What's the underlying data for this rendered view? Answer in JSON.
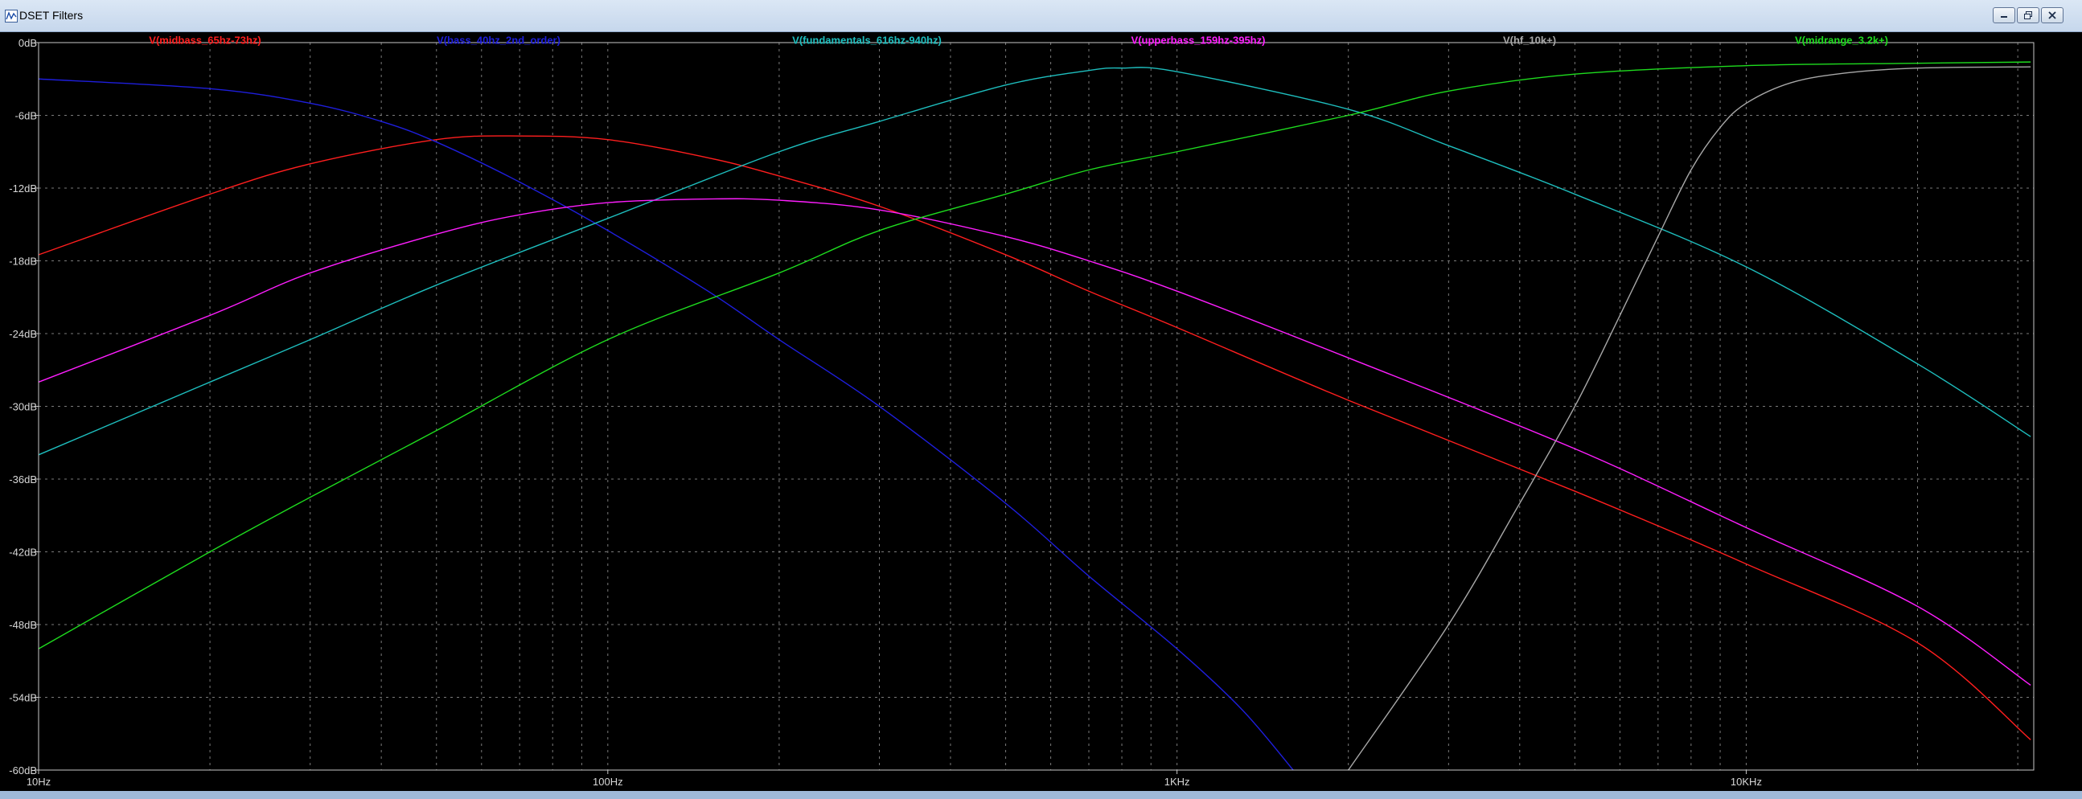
{
  "window": {
    "title": "DSET Filters",
    "icon": "ltspice-waveform-icon",
    "controls": [
      "minimize-icon",
      "restore-icon",
      "close-icon"
    ]
  },
  "chart_data": {
    "type": "line",
    "xscale": "log",
    "xlim": [
      10,
      32000
    ],
    "ylim": [
      -60,
      0
    ],
    "xlabel": "",
    "ylabel": "",
    "title": "",
    "grid": true,
    "legend": "top",
    "background": "#000000",
    "grid_color": "#7a7a7a",
    "x_tick_labels": [
      {
        "value": 10,
        "label": "10Hz"
      },
      {
        "value": 100,
        "label": "100Hz"
      },
      {
        "value": 1000,
        "label": "1KHz"
      },
      {
        "value": 10000,
        "label": "10KHz"
      }
    ],
    "y_tick_labels": [
      {
        "value": 0,
        "label": "0dB"
      },
      {
        "value": -6,
        "label": "-6dB"
      },
      {
        "value": -12,
        "label": "-12dB"
      },
      {
        "value": -18,
        "label": "-18dB"
      },
      {
        "value": -24,
        "label": "-24dB"
      },
      {
        "value": -30,
        "label": "-30dB"
      },
      {
        "value": -36,
        "label": "-36dB"
      },
      {
        "value": -42,
        "label": "-42dB"
      },
      {
        "value": -48,
        "label": "-48dB"
      },
      {
        "value": -54,
        "label": "-54dB"
      },
      {
        "value": -60,
        "label": "-60dB"
      }
    ],
    "series": [
      {
        "name": "V(midbass_65hz-73hz)",
        "color": "#ff1e1e",
        "x": [
          10,
          20,
          30,
          50,
          70,
          100,
          150,
          200,
          300,
          500,
          700,
          1000,
          2000,
          5000,
          10000,
          20000,
          31600
        ],
        "y": [
          -17.5,
          -12.5,
          -10.0,
          -8.0,
          -7.7,
          -8.0,
          -9.5,
          -11.0,
          -13.5,
          -17.5,
          -20.5,
          -23.5,
          -29.5,
          -37.0,
          -43.0,
          -49.5,
          -57.5
        ]
      },
      {
        "name": "V(bass_40hz_2nd_order)",
        "color": "#1e1edc",
        "x": [
          10,
          20,
          30,
          40,
          50,
          70,
          100,
          150,
          200,
          300,
          500,
          700,
          1000,
          1300,
          1600
        ],
        "y": [
          -3.0,
          -3.8,
          -5.0,
          -6.5,
          -8.2,
          -11.5,
          -15.5,
          -20.5,
          -24.5,
          -30.0,
          -38.0,
          -44.0,
          -50.0,
          -55.0,
          -60.0
        ]
      },
      {
        "name": "V(fundamentals_616hz-940hz)",
        "color": "#1ebebe",
        "x": [
          10,
          20,
          30,
          50,
          100,
          200,
          300,
          500,
          700,
          800,
          1000,
          2000,
          3000,
          5000,
          10000,
          20000,
          31600
        ],
        "y": [
          -34.0,
          -28.0,
          -24.5,
          -20.0,
          -14.5,
          -9.0,
          -6.5,
          -3.5,
          -2.3,
          -2.1,
          -2.4,
          -5.5,
          -8.5,
          -12.5,
          -18.5,
          -26.5,
          -32.5
        ]
      },
      {
        "name": "V(upperbass_159hz-395hz)",
        "color": "#ff1eff",
        "x": [
          10,
          20,
          30,
          50,
          70,
          100,
          150,
          200,
          300,
          500,
          700,
          1000,
          2000,
          5000,
          10000,
          20000,
          31600
        ],
        "y": [
          -28.0,
          -22.5,
          -19.0,
          -15.8,
          -14.2,
          -13.2,
          -12.9,
          -13.0,
          -13.8,
          -16.0,
          -18.0,
          -20.5,
          -26.0,
          -33.5,
          -40.0,
          -46.5,
          -53.0
        ]
      },
      {
        "name": "V(hf_10k+)",
        "color": "#a8a8a8",
        "x": [
          2000,
          3000,
          4000,
          5000,
          6000,
          7000,
          8000,
          9000,
          10000,
          12000,
          15000,
          20000,
          31600
        ],
        "y": [
          -60.0,
          -48.0,
          -38.0,
          -30.0,
          -22.5,
          -16.0,
          -10.5,
          -7.0,
          -5.0,
          -3.3,
          -2.5,
          -2.1,
          -2.0
        ]
      },
      {
        "name": "V(midrange_3.2k+)",
        "color": "#1edc1e",
        "x": [
          10,
          20,
          30,
          50,
          100,
          200,
          300,
          500,
          700,
          1000,
          2000,
          3000,
          5000,
          10000,
          20000,
          31600
        ],
        "y": [
          -50.0,
          -42.0,
          -37.5,
          -32.0,
          -24.5,
          -19.0,
          -15.5,
          -12.5,
          -10.5,
          -9.0,
          -6.0,
          -4.0,
          -2.6,
          -1.9,
          -1.7,
          -1.6
        ]
      }
    ]
  }
}
